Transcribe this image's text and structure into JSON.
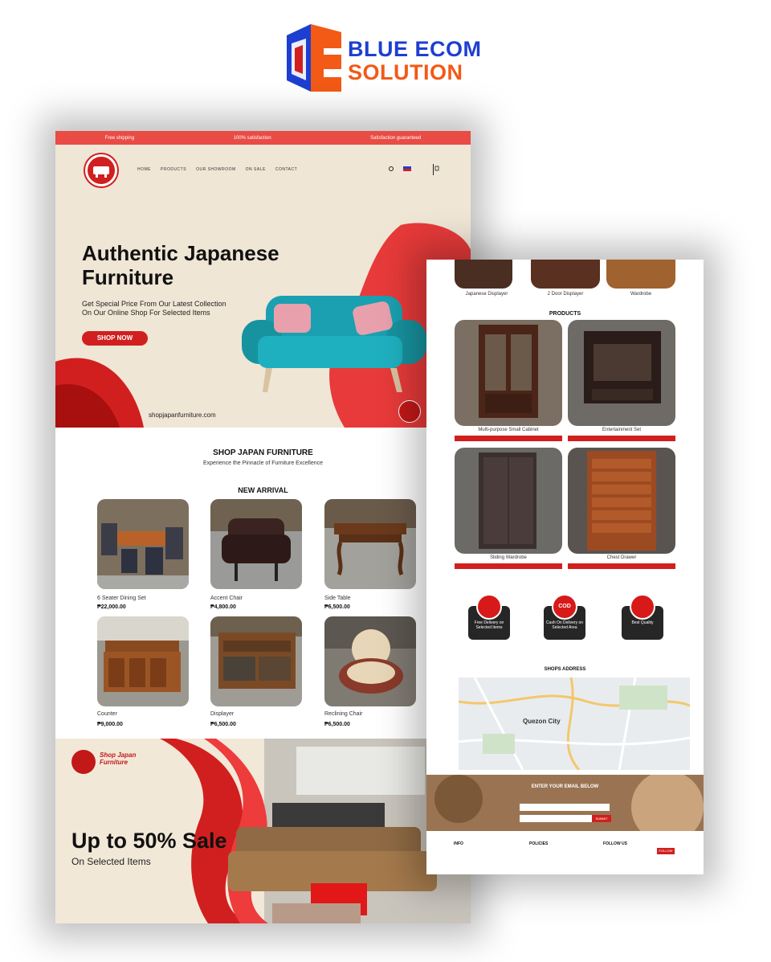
{
  "brand": {
    "line1": "BLUE ECOM",
    "line2": "SOLUTION"
  },
  "siteA": {
    "topbar": [
      "Free shipping",
      "100% satisfaction",
      "Satisfaction guaranteed"
    ],
    "nav": [
      "HOME",
      "PRODUCTS",
      "OUR SHOWROOM",
      "ON SALE",
      "CONTACT"
    ],
    "hero": {
      "title": "Authentic Japanese Furniture",
      "subtitle": "Get Special Price From Our Latest Collection On Our Online Shop For Selected Items",
      "button": "SHOP NOW",
      "url": "shopjapanfurniture.com"
    },
    "section_title": "SHOP JAPAN FURNITURE",
    "section_sub": "Experience the Pinnacle of Furniture Excellence",
    "new_arrival": "NEW ARRIVAL",
    "products": [
      {
        "name": "6 Seater Dining Set",
        "price": "₱22,000.00"
      },
      {
        "name": "Accent Chair",
        "price": "₱4,800.00"
      },
      {
        "name": "Side Table",
        "price": "₱6,500.00"
      },
      {
        "name": "Counter",
        "price": "₱9,000.00"
      },
      {
        "name": "Displayer",
        "price": "₱6,500.00"
      },
      {
        "name": "Reclining Chair",
        "price": "₱6,500.00"
      }
    ],
    "promo": {
      "brand": "Shop Japan Furniture",
      "title": "Up to 50% Sale",
      "subtitle": "On Selected Items"
    }
  },
  "siteB": {
    "top_captions": [
      "Japanese Displayer",
      "2 Door Displayer",
      "Wardrobe"
    ],
    "products_title": "PRODUCTS",
    "products": [
      "Multi-purpose Small Cabinet",
      "Entertainment Set",
      "Sliding Wardrobe",
      "Chest Drawer"
    ],
    "features": [
      "Free Delivery on Selected Items",
      "Cash On Delivery on Selected Area",
      "Best Quality"
    ],
    "cod_badge": "COD",
    "shops_title": "SHOPS ADDRESS",
    "map_label": "Quezon City",
    "email_title": "ENTER YOUR EMAIL BELOW",
    "subscribe": "SUBMIT",
    "footer_heads": [
      "INFO",
      "POLICIES",
      "FOLLOW US"
    ],
    "footer_btn": "FOLLOW"
  }
}
